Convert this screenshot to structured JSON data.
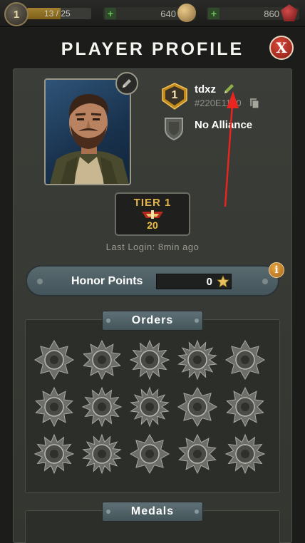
{
  "topbar": {
    "level": "1",
    "xp_text": "13 / 25",
    "xp_progress": 0.52,
    "coins": "640",
    "gems": "860",
    "plus_symbol": "+"
  },
  "header": {
    "title": "PLAYER PROFILE",
    "close_label": "X"
  },
  "profile": {
    "rank": "1",
    "name": "tdxz",
    "player_id": "#220E1130",
    "alliance": "No Alliance",
    "tier_label": "TIER 1",
    "tier_value": "20",
    "last_login": "Last Login: 8min ago"
  },
  "honor": {
    "label": "Honor Points",
    "value": "0",
    "info_symbol": "i"
  },
  "sections": {
    "orders": "Orders",
    "medals": "Medals"
  },
  "orders": [
    {
      "icon": "star-order-icon"
    },
    {
      "icon": "eagle-order-icon"
    },
    {
      "icon": "wreath-order-icon"
    },
    {
      "icon": "sunburst-order-icon"
    },
    {
      "icon": "tank-order-icon"
    },
    {
      "icon": "crosshair-order-icon"
    },
    {
      "icon": "number-one-order-icon"
    },
    {
      "icon": "winged-skull-order-icon"
    },
    {
      "icon": "winged-star-order-icon"
    },
    {
      "icon": "ring-order-icon"
    },
    {
      "icon": "cross-order-icon"
    },
    {
      "icon": "plane-order-icon"
    },
    {
      "icon": "globe-order-icon"
    },
    {
      "icon": "cog-order-icon"
    },
    {
      "icon": "silver-star-order-icon"
    }
  ],
  "colors": {
    "accent_gold": "#e3b54a",
    "tier_value": "#f0c040",
    "close_red": "#b8261c",
    "annotation_red": "#e8251f"
  }
}
